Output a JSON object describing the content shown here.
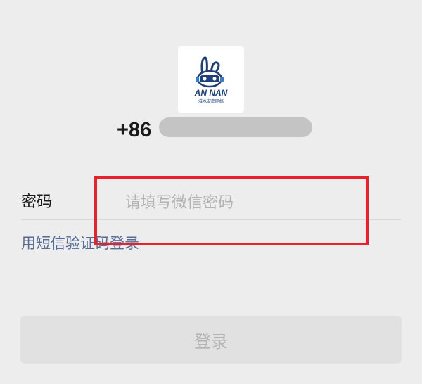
{
  "avatar": {
    "brand_text": "AN NAN",
    "brand_subtext": "淮水安南网络"
  },
  "phone": {
    "country_code": "+86"
  },
  "password": {
    "label": "密码",
    "placeholder": "请填写微信密码"
  },
  "sms_login_link": "用短信验证码登录",
  "login_button": "登录",
  "colors": {
    "background": "#ededed",
    "link": "#576b95",
    "highlight": "#e8212b",
    "button_disabled_bg": "#e1e1e1",
    "placeholder": "#b3b3b3"
  }
}
